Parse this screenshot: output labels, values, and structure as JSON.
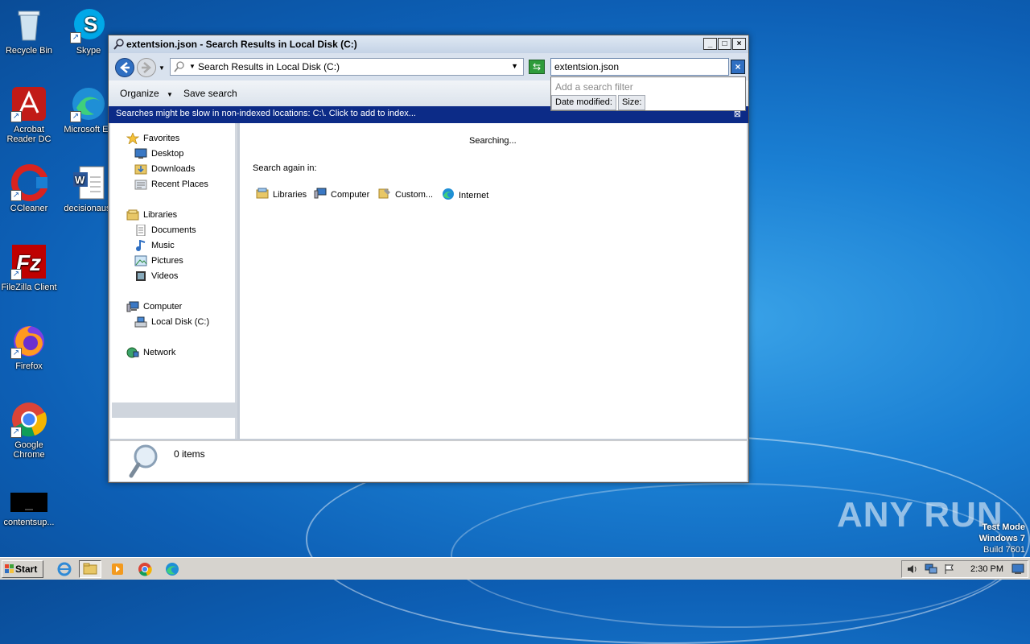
{
  "desktop": {
    "icons": [
      {
        "label": "Recycle Bin",
        "icon": "recycle-bin-icon"
      },
      {
        "label": "Skype",
        "icon": "skype-icon"
      },
      {
        "label": "Acrobat Reader DC",
        "icon": "acrobat-icon"
      },
      {
        "label": "Microsoft Ed",
        "icon": "edge-icon"
      },
      {
        "label": "CCleaner",
        "icon": "ccleaner-icon"
      },
      {
        "label": "decisionaust",
        "icon": "word-doc-icon"
      },
      {
        "label": "FileZilla Client",
        "icon": "filezilla-icon"
      },
      {
        "label": "Firefox",
        "icon": "firefox-icon"
      },
      {
        "label": "Google Chrome",
        "icon": "chrome-icon"
      },
      {
        "label": "contentsup...",
        "icon": "black-file-icon"
      }
    ]
  },
  "window": {
    "title": "extentsion.json - Search Results in Local Disk (C:)",
    "address": "Search Results in Local Disk (C:)",
    "search_value": "extentsion.json",
    "search_hint": "Add a search filter",
    "filters": [
      "Date modified:",
      "Size:"
    ],
    "commands": {
      "organize": "Organize",
      "save_search": "Save search"
    },
    "infobar": "Searches might be slow in non-indexed locations: C:\\. Click to add to index...",
    "nav": {
      "favorites": "Favorites",
      "desktop": "Desktop",
      "downloads": "Downloads",
      "recent": "Recent Places",
      "libraries": "Libraries",
      "documents": "Documents",
      "music": "Music",
      "pictures": "Pictures",
      "videos": "Videos",
      "computer": "Computer",
      "local_disk": "Local Disk (C:)",
      "network": "Network"
    },
    "content": {
      "searching": "Searching...",
      "search_again": "Search again in:",
      "locations": {
        "libraries": "Libraries",
        "computer": "Computer",
        "custom": "Custom...",
        "internet": "Internet"
      }
    },
    "status_items": "0 items"
  },
  "taskbar": {
    "start": "Start",
    "clock": "2:30 PM"
  },
  "watermark": {
    "line1": "Test Mode",
    "line2": "Windows 7",
    "line3": "Build 7601",
    "brand": "ANY RUN"
  },
  "colors": {
    "desktop": "#1a7fd3",
    "infobar": "#0c2b87",
    "titlebar": "#c4d3e6"
  }
}
